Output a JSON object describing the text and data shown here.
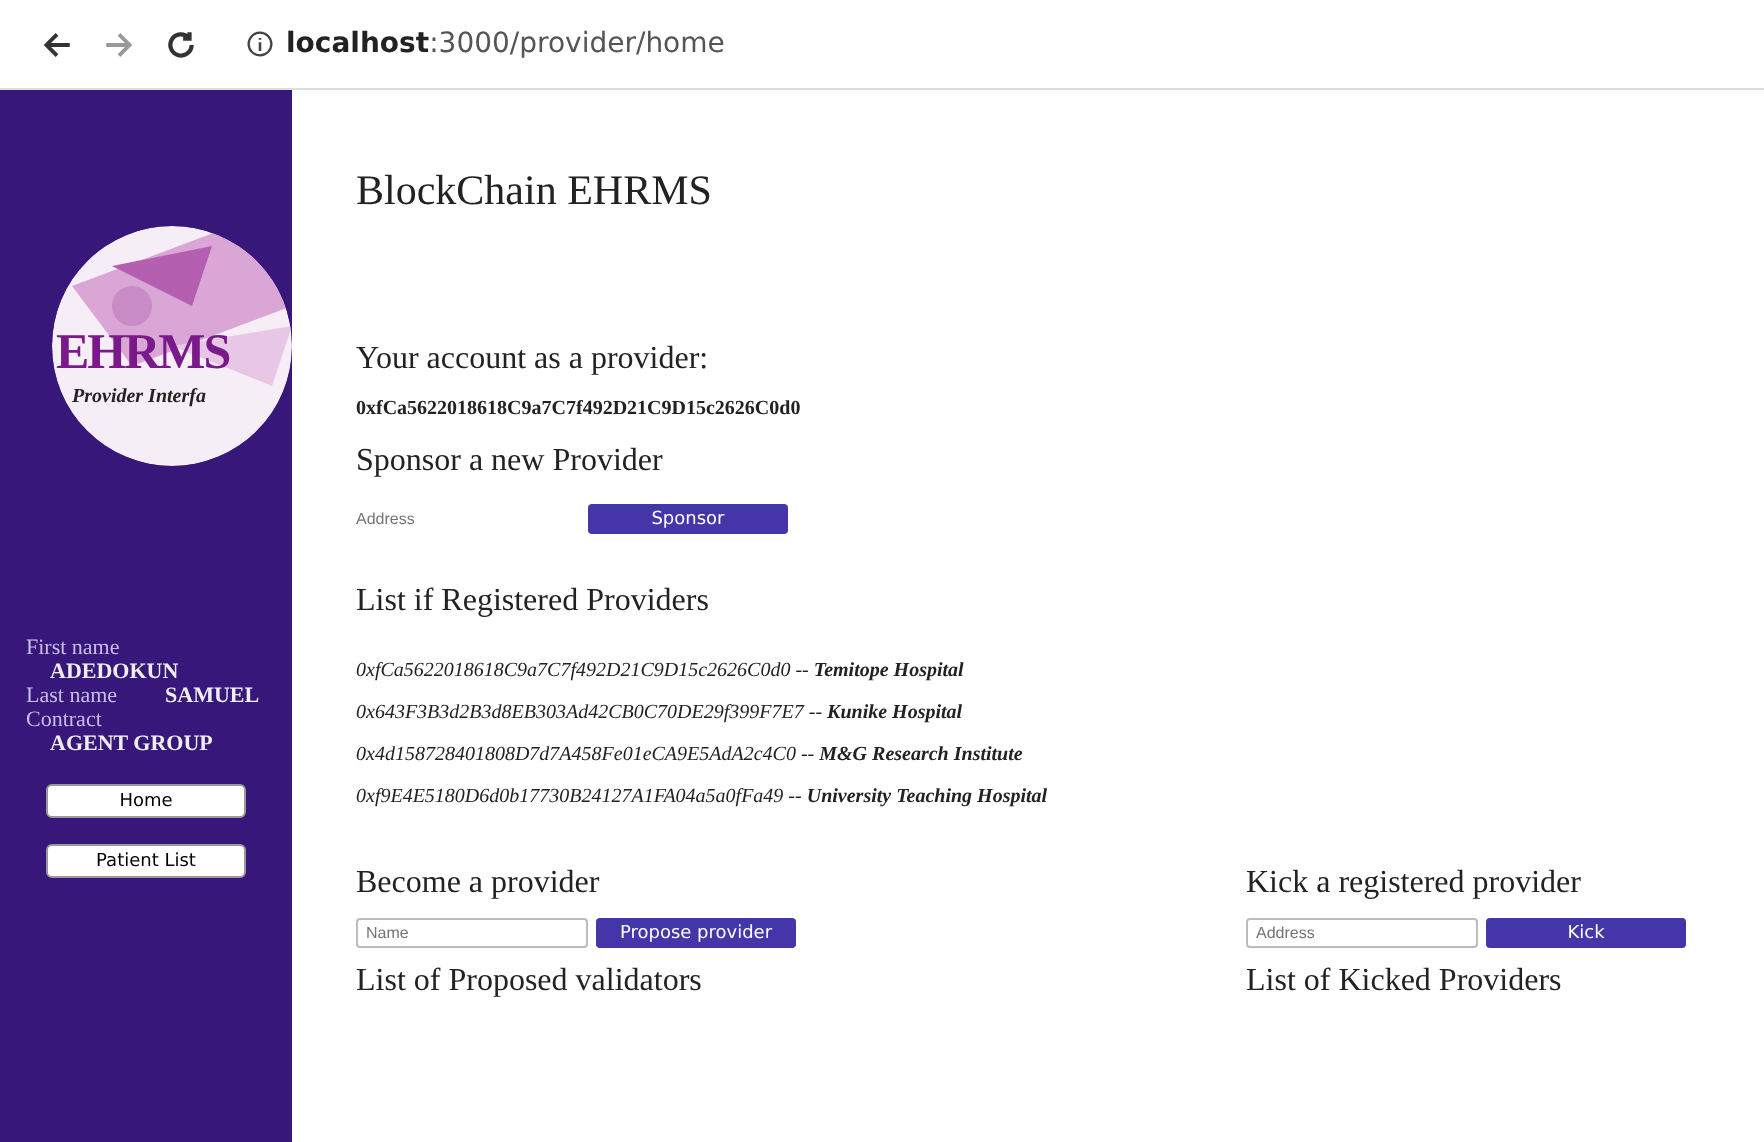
{
  "browser": {
    "url_host": "localhost",
    "url_path": ":3000/provider/home"
  },
  "sidebar": {
    "logo": {
      "title": "EHRMS",
      "subtitle": "Provider Interfa"
    },
    "profile": [
      {
        "label": "First name",
        "value": "ADEDOKUN"
      },
      {
        "label": "Last name",
        "value": "SAMUEL"
      },
      {
        "label": "Contract",
        "value": "AGENT GROUP"
      }
    ],
    "buttons": [
      "Home",
      "Patient List"
    ]
  },
  "title": "BlockChain EHRMS",
  "account": {
    "heading": "Your account as a provider:",
    "address": "0xfCa5622018618C9a7C7f492D21C9D15c2626C0d0"
  },
  "sponsor": {
    "heading": "Sponsor a new Provider",
    "placeholder": "Address",
    "button": "Sponsor"
  },
  "registered": {
    "heading": "List if Registered Providers",
    "items": [
      {
        "text": "0xfCa5622018618C9a7C7f492D21C9D15c2626C0d0 -- **Temitope Hospital**"
      },
      {
        "text": "0x643F3B3d2B3d8EB303Ad42CB0C70DE29f399F7E7 -- **Kunike Hospital**"
      },
      {
        "text": "0x4d158728401808D7d7A458Fe01eCA9E5AdA2c4C0 -- **M&G Research Institute**"
      },
      {
        "text": "0xf9E4E5180D6d0b17730B24127A1FA04a5a0fFa49 -- **University Teaching Hospital**"
      }
    ]
  },
  "become": {
    "heading": "Become a provider",
    "placeholder": "Name",
    "button": "Propose provider",
    "list_heading": "List of Proposed validators"
  },
  "kick": {
    "heading": "Kick a registered provider",
    "placeholder": "Address",
    "button": "Kick",
    "list_heading": "List of Kicked Providers"
  }
}
